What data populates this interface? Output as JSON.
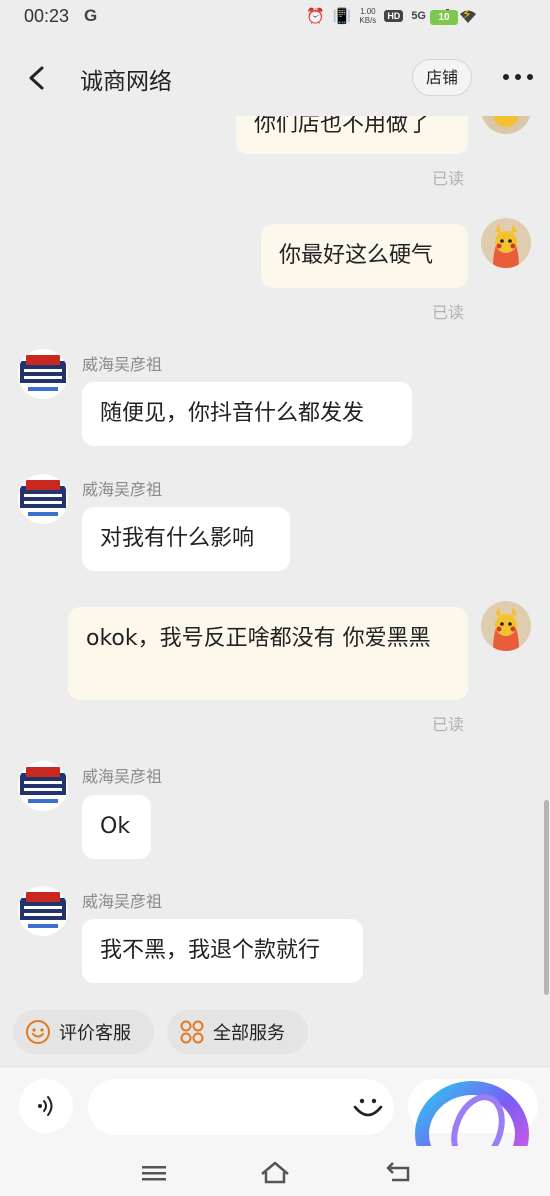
{
  "status_bar": {
    "time": "00:23",
    "carrier_icon": "G",
    "speed_value": "1.00",
    "speed_unit": "KB/s",
    "hd_badge": "HD",
    "network": "5G",
    "battery_level": "10"
  },
  "header": {
    "title": "诚商网络",
    "shop_button": "店铺"
  },
  "messages": [
    {
      "side": "out",
      "text": "你们店也不用做了",
      "status": "已读"
    },
    {
      "side": "out",
      "text": "你最好这么硬气",
      "status": "已读"
    },
    {
      "side": "in",
      "sender": "威海吴彦祖",
      "text": "随便见，你抖音什么都发发"
    },
    {
      "side": "in",
      "sender": "威海吴彦祖",
      "text": "对我有什么影响"
    },
    {
      "side": "out",
      "text": "okok，我号反正啥都没有 你爱黑黑",
      "status": "已读"
    },
    {
      "side": "in",
      "sender": "威海吴彦祖",
      "text": "Ok"
    },
    {
      "side": "in",
      "sender": "威海吴彦祖",
      "text": "我不黑，我退个款就行"
    }
  ],
  "quick_actions": {
    "rate": "评价客服",
    "services": "全部服务"
  },
  "input": {
    "placeholder": ""
  },
  "colors": {
    "background": "#ededed",
    "outgoing_bubble": "#fcf8eb",
    "incoming_bubble": "#ffffff",
    "accent_orange": "#e07a1f",
    "read_status": "#b2b2b2"
  },
  "icons": [
    "back-arrow-icon",
    "more-dots-icon",
    "smiley-icon",
    "grid-icon",
    "voice-icon",
    "emoji-icon",
    "menu-icon",
    "home-icon",
    "return-icon"
  ]
}
